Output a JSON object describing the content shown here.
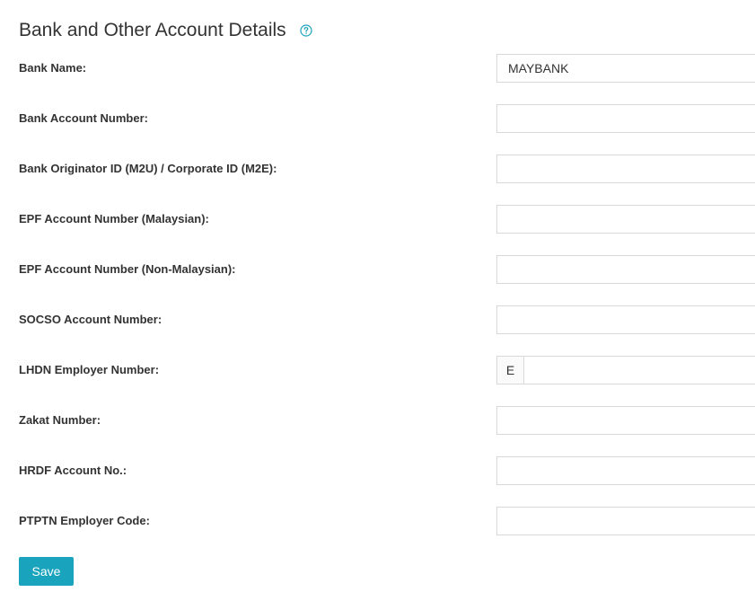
{
  "header": {
    "title": "Bank and Other Account Details",
    "help_icon": "question-circle-icon"
  },
  "fields": [
    {
      "label": "Bank Name:",
      "value": "MAYBANK",
      "prefix": ""
    },
    {
      "label": "Bank Account Number:",
      "value": "",
      "prefix": ""
    },
    {
      "label": "Bank Originator ID (M2U) / Corporate ID (M2E):",
      "value": "",
      "prefix": ""
    },
    {
      "label": "EPF Account Number (Malaysian):",
      "value": "",
      "prefix": ""
    },
    {
      "label": "EPF Account Number (Non-Malaysian):",
      "value": "",
      "prefix": ""
    },
    {
      "label": "SOCSO Account Number:",
      "value": "",
      "prefix": ""
    },
    {
      "label": "LHDN Employer Number:",
      "value": "",
      "prefix": "E"
    },
    {
      "label": "Zakat Number:",
      "value": "",
      "prefix": ""
    },
    {
      "label": "HRDF Account No.:",
      "value": "",
      "prefix": ""
    },
    {
      "label": "PTPTN Employer Code:",
      "value": "",
      "prefix": ""
    }
  ],
  "actions": {
    "save_label": "Save"
  },
  "colors": {
    "accent": "#1aa3bd",
    "border": "#d9d9d9",
    "text": "#333333"
  }
}
